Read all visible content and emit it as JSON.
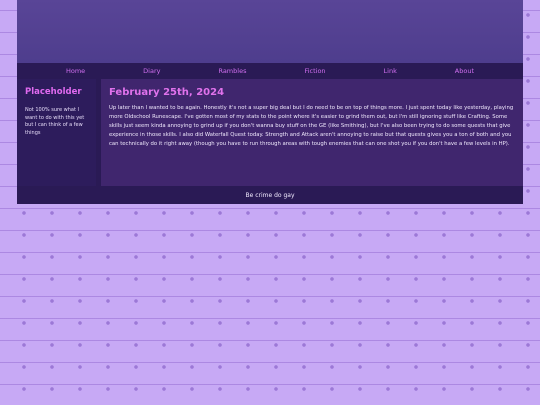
{
  "nav": {
    "items": [
      "Home",
      "Diary",
      "Rambles",
      "Fiction",
      "Link",
      "About"
    ]
  },
  "sidebar": {
    "title": "Placeholder",
    "text": "Not 100% sure what I want to do with this yet but I can think of a few things"
  },
  "main": {
    "title": "February 25th, 2024",
    "body": "Up later than I wanted to be again. Honestly it's not a super big deal but I do need to be on top of things more. I just spent today like yesterday, playing more Oldschool Runescape. I've gotten most of my stats to the point where it's easier to grind them out, but I'm still ignoring stuff like Crafting. Some skills just seem kinda annoying to grind up if you don't wanna buy stuff on the GE (like Smithing), but I've also been trying to do some quests that give experience in those skills. I also did Waterfall Quest today. Strength and Attack aren't annoying to raise but that quests gives you a ton of both and you can technically do it right away (though you have to run through areas with tough enemies that can one shot you if you don't have a few levels in HP)."
  },
  "footer": {
    "text": "Be crime do gay"
  },
  "colors": {
    "background": "#c7a9f5",
    "header": "#594597",
    "nav": "#2a1a55",
    "accent": "#e06af0",
    "main_bg": "#40266e",
    "sidebar_bg": "#2d1c5c"
  }
}
